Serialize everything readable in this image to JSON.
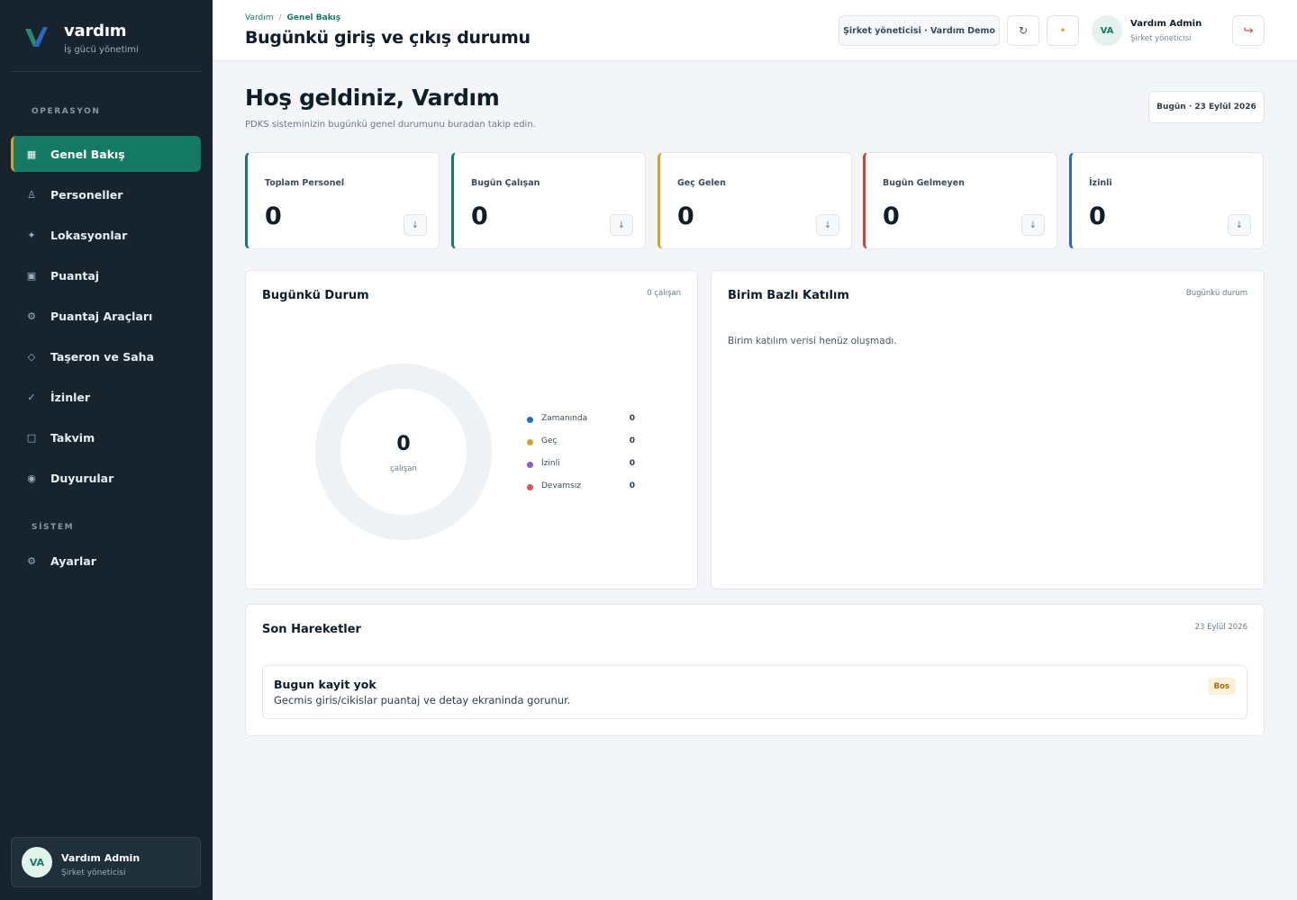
{
  "brand": {
    "name": "vardım",
    "subtitle": "İş gücü yönetimi"
  },
  "sidebar": {
    "sections": [
      {
        "label": "OPERASYON"
      },
      {
        "label": "SİSTEM"
      }
    ],
    "items": [
      {
        "label": "Genel Bakış",
        "icon": "grid-icon",
        "glyph": "▦",
        "active": true
      },
      {
        "label": "Personeller",
        "icon": "user-icon",
        "glyph": "♙"
      },
      {
        "label": "Lokasyonlar",
        "icon": "location-icon",
        "glyph": "✦"
      },
      {
        "label": "Puantaj",
        "icon": "timesheet-icon",
        "glyph": "▣"
      },
      {
        "label": "Puantaj Araçları",
        "icon": "gear-icon",
        "glyph": "⚙"
      },
      {
        "label": "Taşeron ve Saha",
        "icon": "diamond-icon",
        "glyph": "◇"
      },
      {
        "label": "İzinler",
        "icon": "check-icon",
        "glyph": "✓"
      },
      {
        "label": "Takvim",
        "icon": "calendar-icon",
        "glyph": "□"
      },
      {
        "label": "Duyurular",
        "icon": "announcement-icon",
        "glyph": "◉"
      },
      {
        "label": "Ayarlar",
        "icon": "settings-icon",
        "glyph": "⚙"
      }
    ],
    "user": {
      "initials": "VA",
      "name": "Vardım Admin",
      "role": "Şirket yöneticisi"
    }
  },
  "header": {
    "breadcrumb": {
      "root": "Vardım",
      "separator": "/",
      "current": "Genel Bakış"
    },
    "title": "Bugünkü giriş ve çıkış durumu",
    "company": "Şirket yöneticisi · Vardım Demo",
    "refresh_glyph": "↻",
    "status_glyph": "•",
    "logout_glyph": "↪",
    "user": {
      "initials": "VA",
      "name": "Vardım Admin",
      "role": "Şirket yöneticisi"
    }
  },
  "welcome": {
    "title": "Hoş geldiniz, Vardım",
    "subtitle": "PDKS sisteminizin bugünkü genel durumunu buradan takip edin.",
    "date": "Bugün · 23 Eylül 2026"
  },
  "stats": [
    {
      "label": "Toplam Personel",
      "value": "0",
      "accent": "#157a63"
    },
    {
      "label": "Bugün Çalışan",
      "value": "0",
      "accent": "#157a63"
    },
    {
      "label": "Geç Gelen",
      "value": "0",
      "accent": "#d4a32b"
    },
    {
      "label": "Bugün Gelmeyen",
      "value": "0",
      "accent": "#c8453c"
    },
    {
      "label": "İzinli",
      "value": "0",
      "accent": "#2f63c4"
    }
  ],
  "stat_button_glyph": "↓",
  "today_status": {
    "title": "Bugünkü Durum",
    "meta": "0 çalışan",
    "center_value": "0",
    "center_label": "çalışan",
    "legend": [
      {
        "label": "Zamanında",
        "value": "0",
        "color": "#1f6fd1"
      },
      {
        "label": "Geç",
        "value": "0",
        "color": "#d4a32b"
      },
      {
        "label": "İzinli",
        "value": "0",
        "color": "#8b5cd6"
      },
      {
        "label": "Devamsız",
        "value": "0",
        "color": "#e0524a"
      }
    ]
  },
  "unit_attendance": {
    "title": "Birim Bazlı Katılım",
    "meta": "Bugünkü durum",
    "empty": "Birim katılım verisi henüz oluşmadı."
  },
  "recent": {
    "title": "Son Hareketler",
    "meta": "23 Eylül 2026",
    "empty_title": "Bugun kayit yok",
    "empty_desc": "Gecmis giris/cikislar puantaj ve detay ekraninda gorunur.",
    "badge": "Bos"
  }
}
